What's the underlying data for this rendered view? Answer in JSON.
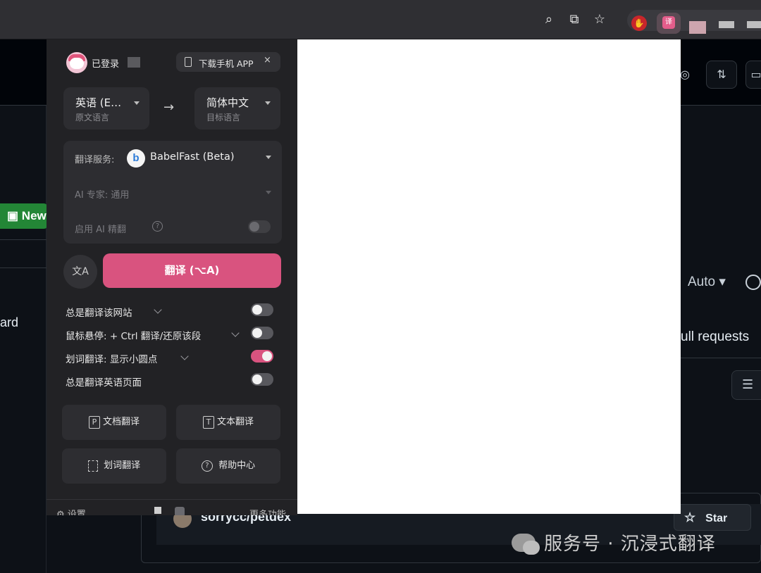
{
  "browser": {
    "icons": [
      "zoom-icon",
      "cast-icon",
      "star-icon"
    ],
    "ext_red_glyph": "✋",
    "ext_imm_glyph": "译"
  },
  "github": {
    "new_button": "New",
    "left_text": "ard",
    "theme_value": "Auto",
    "tab_label": "ull requests",
    "repo": "sorrycc/petdex",
    "star_button": "Star"
  },
  "popup": {
    "logged_in": "已登录",
    "download_app": "下载手机 APP",
    "close_glyph": "×",
    "source_lang": {
      "value": "英语 (E…",
      "caption": "原文语言"
    },
    "target_lang": {
      "value": "简体中文",
      "caption": "目标语言"
    },
    "arrow": "→",
    "service": {
      "label": "翻译服务:",
      "name": "BabelFast (Beta)",
      "logo_letter": "b"
    },
    "ai_expert": "AI 专家:  通用",
    "ai_enhance": "启用 AI 精翻",
    "translate_button": "翻译 (⌥A)",
    "options": [
      {
        "label": "总是翻译该网站",
        "has_chevron": true,
        "enabled": false
      },
      {
        "label": "鼠标悬停:  + Ctrl 翻译/还原该段",
        "has_chevron": true,
        "enabled": false
      },
      {
        "label": "划词翻译:  显示小圆点",
        "has_chevron": true,
        "enabled": true
      },
      {
        "label": "总是翻译英语页面",
        "has_chevron": false,
        "enabled": false
      }
    ],
    "tools": [
      {
        "label": "文档翻译",
        "icon": "pdf-icon"
      },
      {
        "label": "文本翻译",
        "icon": "text-icon"
      },
      {
        "label": "划词翻译",
        "icon": "selection-icon"
      },
      {
        "label": "帮助中心",
        "icon": "help-icon"
      }
    ],
    "settings": "设置",
    "more": "更多功能",
    "accent_color": "#d9537f"
  },
  "watermark": "服务号 · 沉浸式翻译"
}
